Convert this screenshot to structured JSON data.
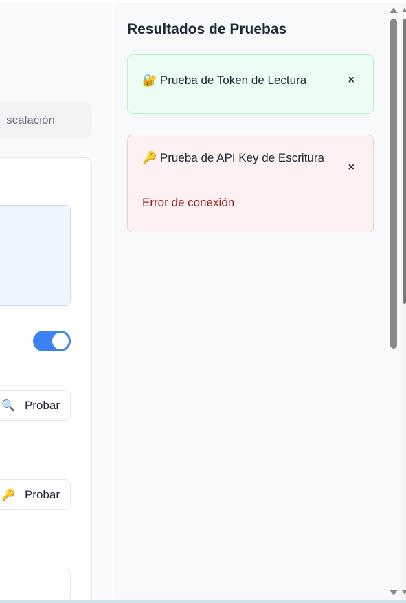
{
  "left_panel": {
    "tab_partial_label": "scalación",
    "buttons": [
      {
        "icon": "🔍",
        "icon_name": "magnifier-icon",
        "label": "Probar"
      },
      {
        "icon": "🔑",
        "icon_name": "key-icon",
        "label": "Probar"
      }
    ],
    "toggle_on": true
  },
  "results": {
    "title": "Resultados de Pruebas",
    "items": [
      {
        "status": "success",
        "icon": "🔐",
        "icon_name": "lock-icon",
        "title": "Prueba de Token de Lectura",
        "close": "×"
      },
      {
        "status": "error",
        "icon": "🔑",
        "icon_name": "key-icon",
        "title": "Prueba de API Key de Escritura",
        "close": "×",
        "message": "Error de conexión"
      }
    ]
  },
  "colors": {
    "accent": "#3b82f6",
    "success_bg": "#ecfdf3",
    "error_bg": "#fef1f1",
    "error_text": "#991b1b"
  }
}
